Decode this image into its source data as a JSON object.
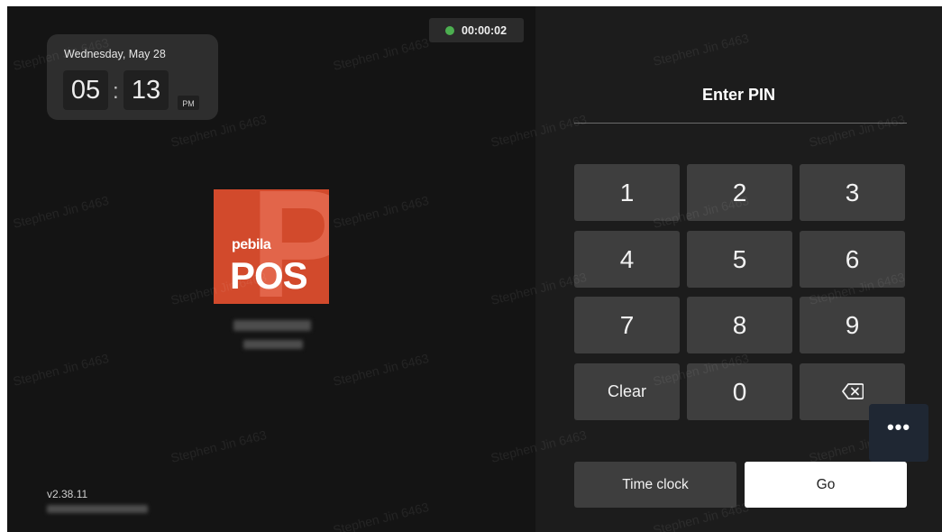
{
  "watermark": "Stephen Jin 6463",
  "clock": {
    "date": "Wednesday, May 28",
    "hours": "05",
    "colon": ":",
    "minutes": "13",
    "ampm": "PM"
  },
  "timer": {
    "elapsed": "00:00:02",
    "status_color": "#4caf50"
  },
  "logo": {
    "small_text": "pebila",
    "big_text": "POS",
    "brand_color": "#d24a2c"
  },
  "version": "v2.38.11",
  "pin": {
    "title": "Enter PIN",
    "keys": [
      "1",
      "2",
      "3",
      "4",
      "5",
      "6",
      "7",
      "8",
      "9",
      "Clear",
      "0"
    ],
    "backspace_icon": "backspace-icon"
  },
  "actions": {
    "time_clock": "Time clock",
    "go": "Go",
    "more": "•••"
  }
}
